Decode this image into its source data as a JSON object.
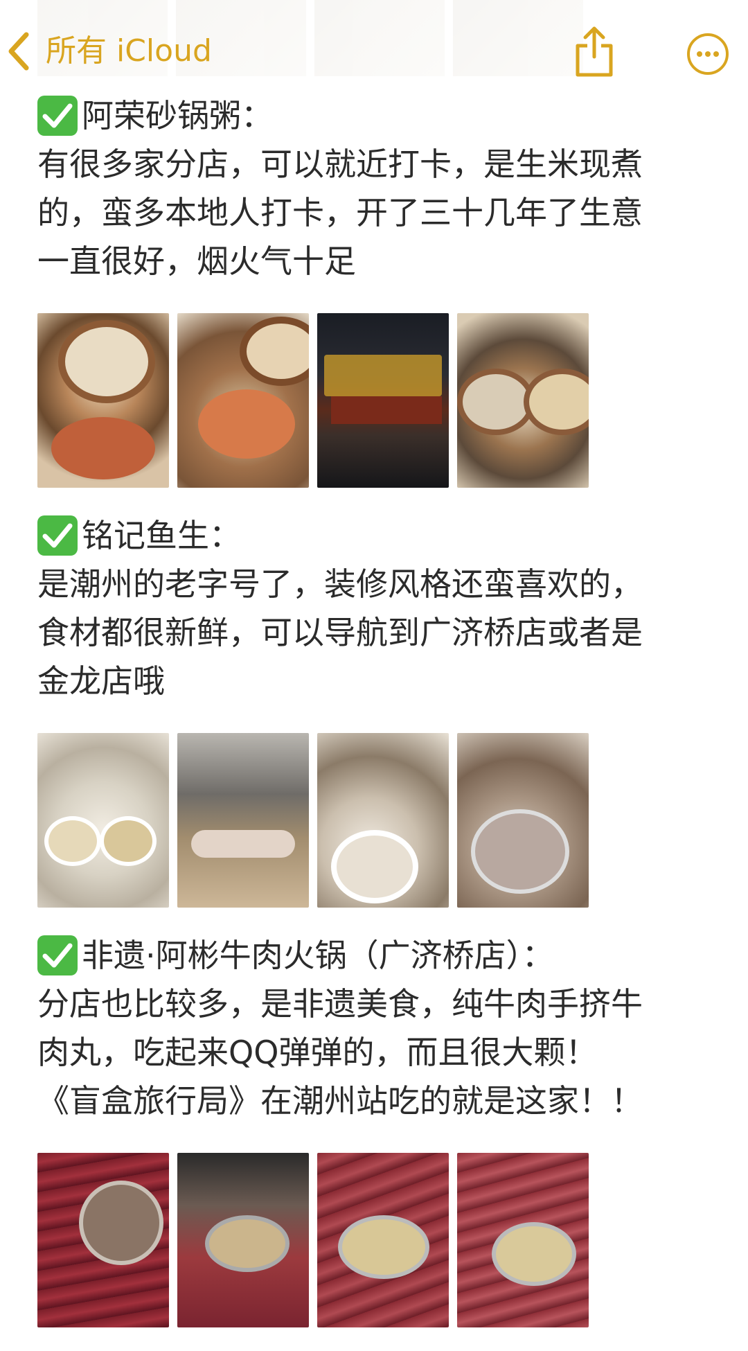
{
  "nav": {
    "back_label": "所有 iCloud"
  },
  "sections": [
    {
      "title": "阿荣砂锅粥：",
      "body": "有很多家分店，可以就近打卡，是生米现煮\n的，蛮多本地人打卡，开了三十几年了生意\n一直很好，烟火气十足"
    },
    {
      "title": "铭记鱼生：",
      "body": "是潮州的老字号了，装修风格还蛮喜欢的，\n食材都很新鲜，可以导航到广济桥店或者是\n金龙店哦"
    },
    {
      "title": "非遗·阿彬牛肉火锅（广济桥店）：",
      "body": "分店也比较多，是非遗美食，纯牛肉手挤牛\n肉丸，吃起来QQ弹弹的，而且很大颗！\n《盲盒旅行局》在潮州站吃的就是这家！！"
    }
  ],
  "colors": {
    "accent": "#d9a520",
    "check": "#4bb944"
  }
}
